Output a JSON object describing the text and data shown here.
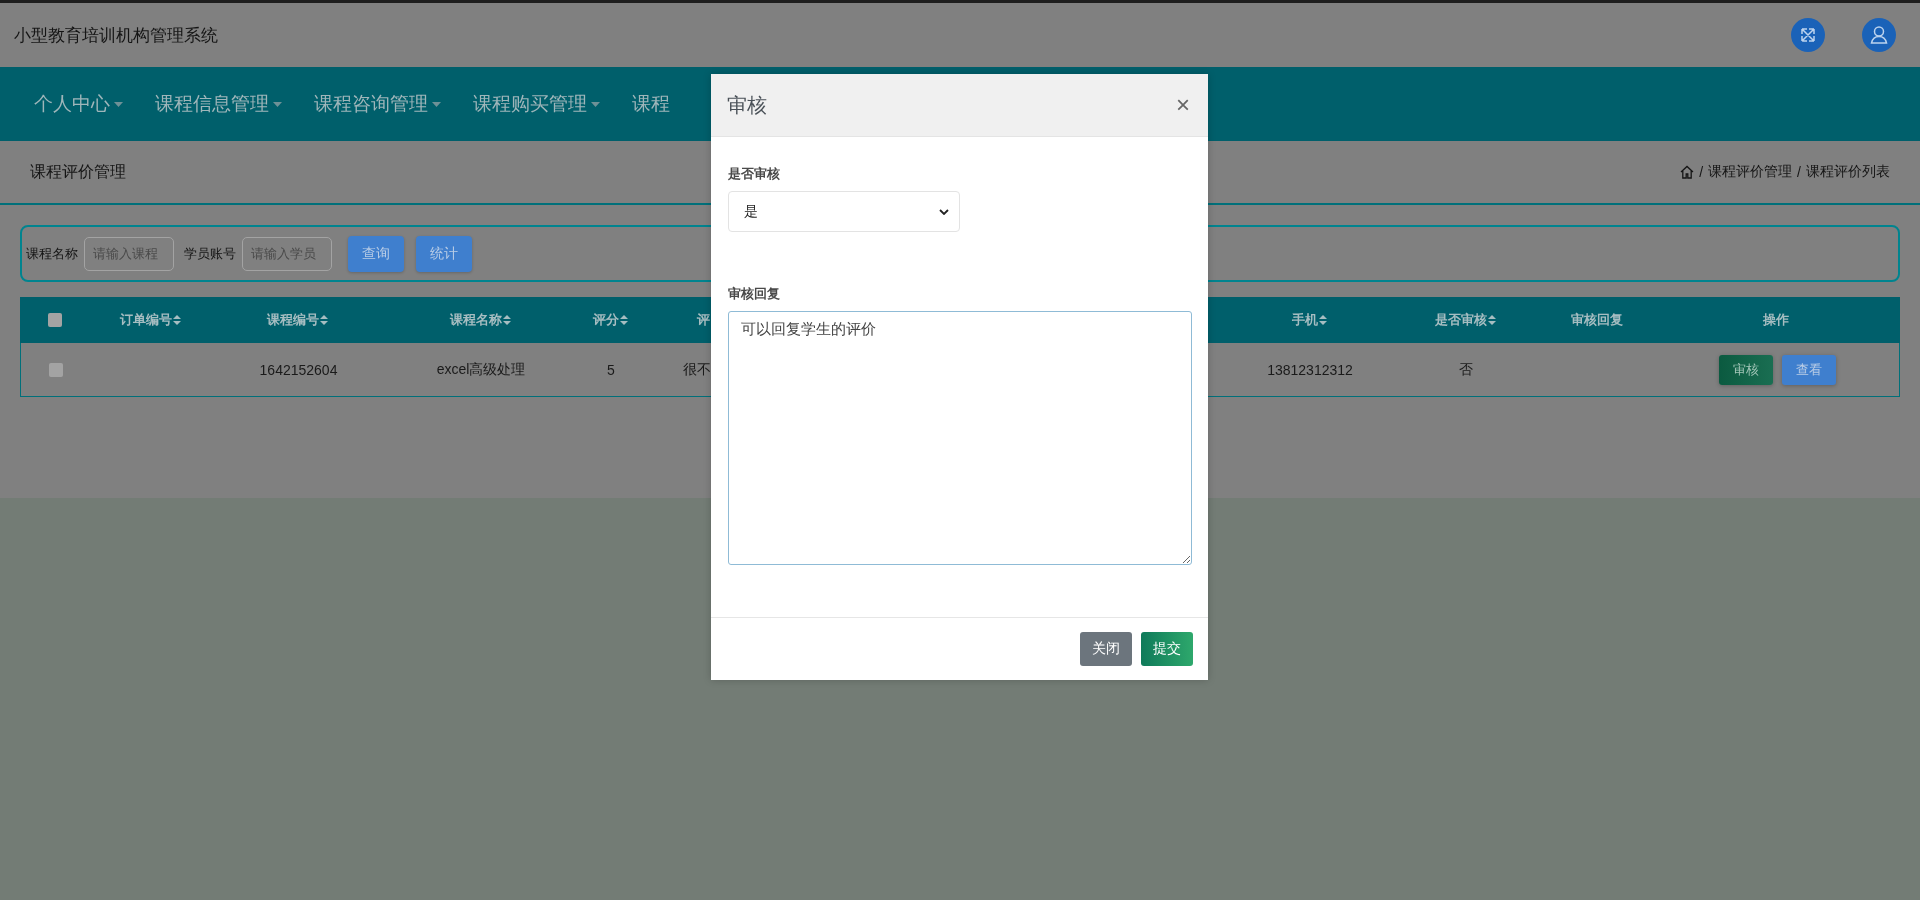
{
  "app_title": "小型教育培训机构管理系统",
  "nav": [
    {
      "label": "个人中心",
      "dropdown": true
    },
    {
      "label": "课程信息管理",
      "dropdown": true
    },
    {
      "label": "课程咨询管理",
      "dropdown": true
    },
    {
      "label": "课程购买管理",
      "dropdown": true
    },
    {
      "label": "课程",
      "dropdown": false
    }
  ],
  "page_title": "课程评价管理",
  "breadcrumb": {
    "separator": "/",
    "items": [
      "课程评价管理",
      "课程评价列表"
    ]
  },
  "search": {
    "fields": [
      {
        "label": "课程名称",
        "placeholder": "请输入课程"
      },
      {
        "label": "学员账号",
        "placeholder": "请输入学员"
      }
    ],
    "buttons": [
      "查询",
      "统计"
    ]
  },
  "table": {
    "header_checked": false,
    "columns": [
      {
        "label": "订单编号",
        "sortable": true
      },
      {
        "label": "课程编号",
        "sortable": true
      },
      {
        "label": "课程名称",
        "sortable": true
      },
      {
        "label": "评分",
        "sortable": true
      },
      {
        "label": "评",
        "sortable": false
      },
      {
        "label": "手机",
        "sortable": true
      },
      {
        "label": "是否审核",
        "sortable": true
      },
      {
        "label": "审核回复",
        "sortable": false
      },
      {
        "label": "操作",
        "sortable": false
      }
    ],
    "rows": [
      {
        "checked": false,
        "cells": [
          null,
          "1642152604",
          "excel高级处理",
          "5",
          "很不",
          "13812312312",
          "否",
          null
        ],
        "actions": [
          {
            "label": "审核",
            "kind": "success"
          },
          {
            "label": "查看",
            "kind": "primary"
          }
        ]
      }
    ]
  },
  "modal": {
    "title": "审核",
    "close": "×",
    "fields": [
      {
        "kind": "select",
        "label": "是否审核",
        "value": "是"
      },
      {
        "kind": "textarea",
        "label": "审核回复",
        "value": "可以回复学生的评价"
      }
    ],
    "buttons": [
      {
        "label": "关闭",
        "kind": "secondary"
      },
      {
        "label": "提交",
        "kind": "primary"
      }
    ]
  }
}
